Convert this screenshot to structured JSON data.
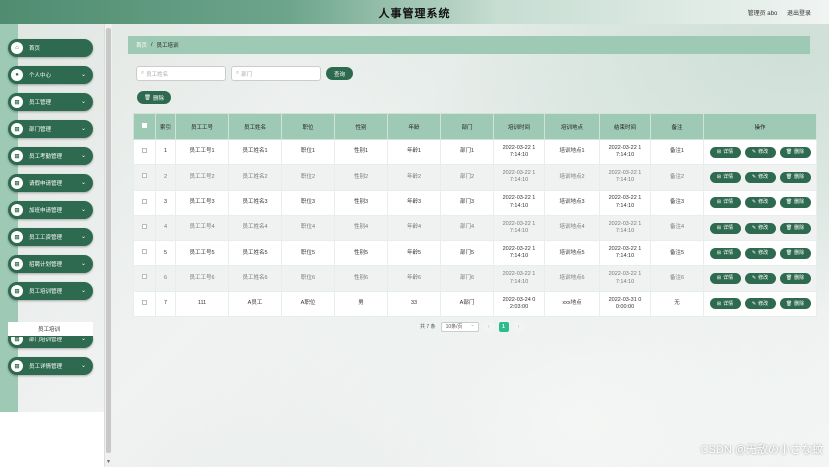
{
  "header": {
    "title": "人事管理系统",
    "user": "管理员 abo",
    "logout": "退出登录"
  },
  "sidebar": {
    "items": [
      {
        "label": "首页",
        "icon": "home-icon",
        "expandable": false
      },
      {
        "label": "个人中心",
        "icon": "user-icon",
        "expandable": true
      },
      {
        "label": "员工管理",
        "icon": "grid-icon",
        "expandable": true
      },
      {
        "label": "部门管理",
        "icon": "grid-icon",
        "expandable": true
      },
      {
        "label": "员工考勤管理",
        "icon": "grid-icon",
        "expandable": true
      },
      {
        "label": "请假申请管理",
        "icon": "grid-icon",
        "expandable": true
      },
      {
        "label": "加班申请管理",
        "icon": "grid-icon",
        "expandable": true
      },
      {
        "label": "员工工资管理",
        "icon": "grid-icon",
        "expandable": true
      },
      {
        "label": "招聘计划管理",
        "icon": "grid-icon",
        "expandable": true
      },
      {
        "label": "员工培训管理",
        "icon": "grid-icon",
        "expandable": true
      },
      {
        "label": "部门培训管理",
        "icon": "grid-icon",
        "expandable": true
      },
      {
        "label": "员工详情管理",
        "icon": "grid-icon",
        "expandable": true
      }
    ],
    "active_sub": "员工培训"
  },
  "breadcrumb": {
    "home": "首页",
    "sep": "/",
    "current": "员工培训"
  },
  "search": {
    "name_placeholder": "员工姓名",
    "dept_placeholder": "部门",
    "query_button": "查询",
    "delete_button": "删除"
  },
  "table": {
    "headers": [
      "索引",
      "员工工号",
      "员工姓名",
      "职位",
      "性别",
      "年龄",
      "部门",
      "培训时间",
      "培训地点",
      "结束时间",
      "备注",
      "操作"
    ],
    "actions": [
      "详情",
      "修改",
      "删除"
    ],
    "rows": [
      [
        "1",
        "员工工号1",
        "员工姓名1",
        "职位1",
        "性别1",
        "年龄1",
        "部门1",
        "2022-03-22 1\n7:14:10",
        "培训地点1",
        "2022-03-22 1\n7:14:10",
        "备注1"
      ],
      [
        "2",
        "员工工号2",
        "员工姓名2",
        "职位2",
        "性别2",
        "年龄2",
        "部门2",
        "2022-03-22 1\n7:14:10",
        "培训地点2",
        "2022-03-22 1\n7:14:10",
        "备注2"
      ],
      [
        "3",
        "员工工号3",
        "员工姓名3",
        "职位3",
        "性别3",
        "年龄3",
        "部门3",
        "2022-03-22 1\n7:14:10",
        "培训地点3",
        "2022-03-22 1\n7:14:10",
        "备注3"
      ],
      [
        "4",
        "员工工号4",
        "员工姓名4",
        "职位4",
        "性别4",
        "年龄4",
        "部门4",
        "2022-03-22 1\n7:14:10",
        "培训地点4",
        "2022-03-22 1\n7:14:10",
        "备注4"
      ],
      [
        "5",
        "员工工号5",
        "员工姓名5",
        "职位5",
        "性别5",
        "年龄5",
        "部门5",
        "2022-03-22 1\n7:14:10",
        "培训地点5",
        "2022-03-22 1\n7:14:10",
        "备注5"
      ],
      [
        "6",
        "员工工号6",
        "员工姓名6",
        "职位6",
        "性别6",
        "年龄6",
        "部门6",
        "2022-03-22 1\n7:14:10",
        "培训地点6",
        "2022-03-22 1\n7:14:10",
        "备注6"
      ],
      [
        "7",
        "111",
        "A员工",
        "A职位",
        "男",
        "33",
        "A部门",
        "2022-03-24 0\n2:03:00",
        "xxx地点",
        "2022-03-31 0\n0:00:00",
        "无"
      ]
    ]
  },
  "pagination": {
    "total": "共 7 条",
    "page_size": "10条/页",
    "current_page": "1",
    "prev": "‹",
    "next": "›"
  },
  "watermark": "CSDN @无敌の小さな蚊",
  "colors": {
    "primary": "#2e6a4f",
    "header_bg": "#9ec9b4",
    "page_active": "#2dbd8b"
  }
}
